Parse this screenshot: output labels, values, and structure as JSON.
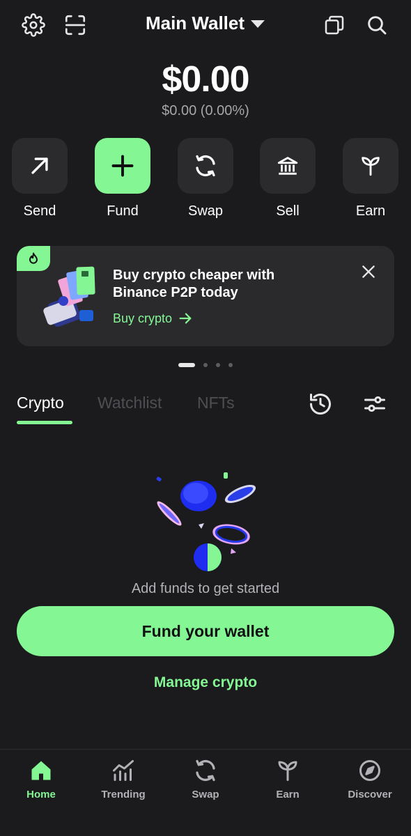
{
  "header": {
    "title": "Main Wallet",
    "icons": [
      "gear-icon",
      "scan-icon",
      "caret-down-icon",
      "copy-icon",
      "search-icon"
    ]
  },
  "balance": {
    "amount": "$0.00",
    "change": "$0.00 (0.00%)"
  },
  "actions": [
    {
      "label": "Send",
      "icon": "arrow-up-right-icon"
    },
    {
      "label": "Fund",
      "icon": "plus-icon"
    },
    {
      "label": "Swap",
      "icon": "swap-icon"
    },
    {
      "label": "Sell",
      "icon": "bank-icon"
    },
    {
      "label": "Earn",
      "icon": "sprout-icon"
    }
  ],
  "promo": {
    "title": "Buy crypto cheaper with Binance P2P today",
    "link": "Buy crypto",
    "pages": 4,
    "active_page": 1
  },
  "tabs": [
    {
      "label": "Crypto",
      "active": true
    },
    {
      "label": "Watchlist",
      "active": false
    },
    {
      "label": "NFTs",
      "active": false
    }
  ],
  "empty": {
    "message": "Add funds to get started",
    "cta": "Fund your wallet",
    "secondary": "Manage crypto"
  },
  "nav": [
    {
      "label": "Home",
      "icon": "home-icon",
      "active": true
    },
    {
      "label": "Trending",
      "icon": "trending-icon",
      "active": false
    },
    {
      "label": "Swap",
      "icon": "swap-icon",
      "active": false
    },
    {
      "label": "Earn",
      "icon": "sprout-icon",
      "active": false
    },
    {
      "label": "Discover",
      "icon": "compass-icon",
      "active": false
    }
  ],
  "colors": {
    "background": "#1b1b1d",
    "accent": "#84f794",
    "surface": "#2b2b2e",
    "muted_text": "#a7a7ab"
  }
}
